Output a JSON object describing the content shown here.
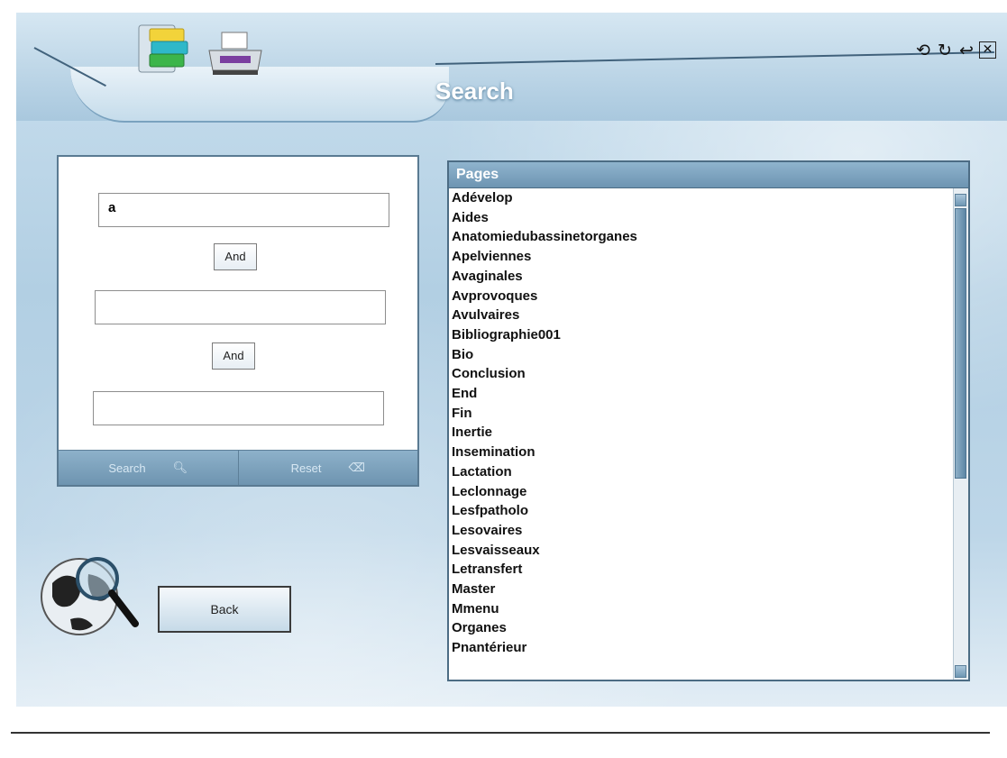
{
  "header": {
    "title": "Search",
    "app_icon": "books-icon",
    "print_icon": "printer-icon",
    "window_controls": [
      {
        "name": "undo-icon",
        "glyph": "⟲"
      },
      {
        "name": "refresh-icon",
        "glyph": "↻"
      },
      {
        "name": "back-arrow-icon",
        "glyph": "↩"
      },
      {
        "name": "close-icon",
        "glyph": "✕"
      }
    ]
  },
  "search": {
    "field1_value": "a",
    "field2_value": "",
    "field3_value": "",
    "operator1_label": "And",
    "operator2_label": "And",
    "search_label": "Search",
    "reset_label": "Reset"
  },
  "nav": {
    "back_label": "Back",
    "globe_icon": "globe-magnifier-icon"
  },
  "pages": {
    "header": "Pages",
    "items": [
      "Adévelop",
      "Aides",
      "Anatomiedubassinetorganes",
      "Apelviennes",
      "Avaginales",
      "Avprovoques",
      "Avulvaires",
      "Bibliographie001",
      "Bio",
      "Conclusion",
      "End",
      "Fin",
      "Inertie",
      "Insemination",
      "Lactation",
      "Leclonnage",
      "Lesfpatholo",
      "Lesovaires",
      "Lesvaisseaux",
      "Letransfert",
      "Master",
      "Mmenu",
      "Organes",
      "Pnantérieur"
    ]
  },
  "colors": {
    "accent": "#6d94b2",
    "panel_border": "#4c6c84"
  }
}
